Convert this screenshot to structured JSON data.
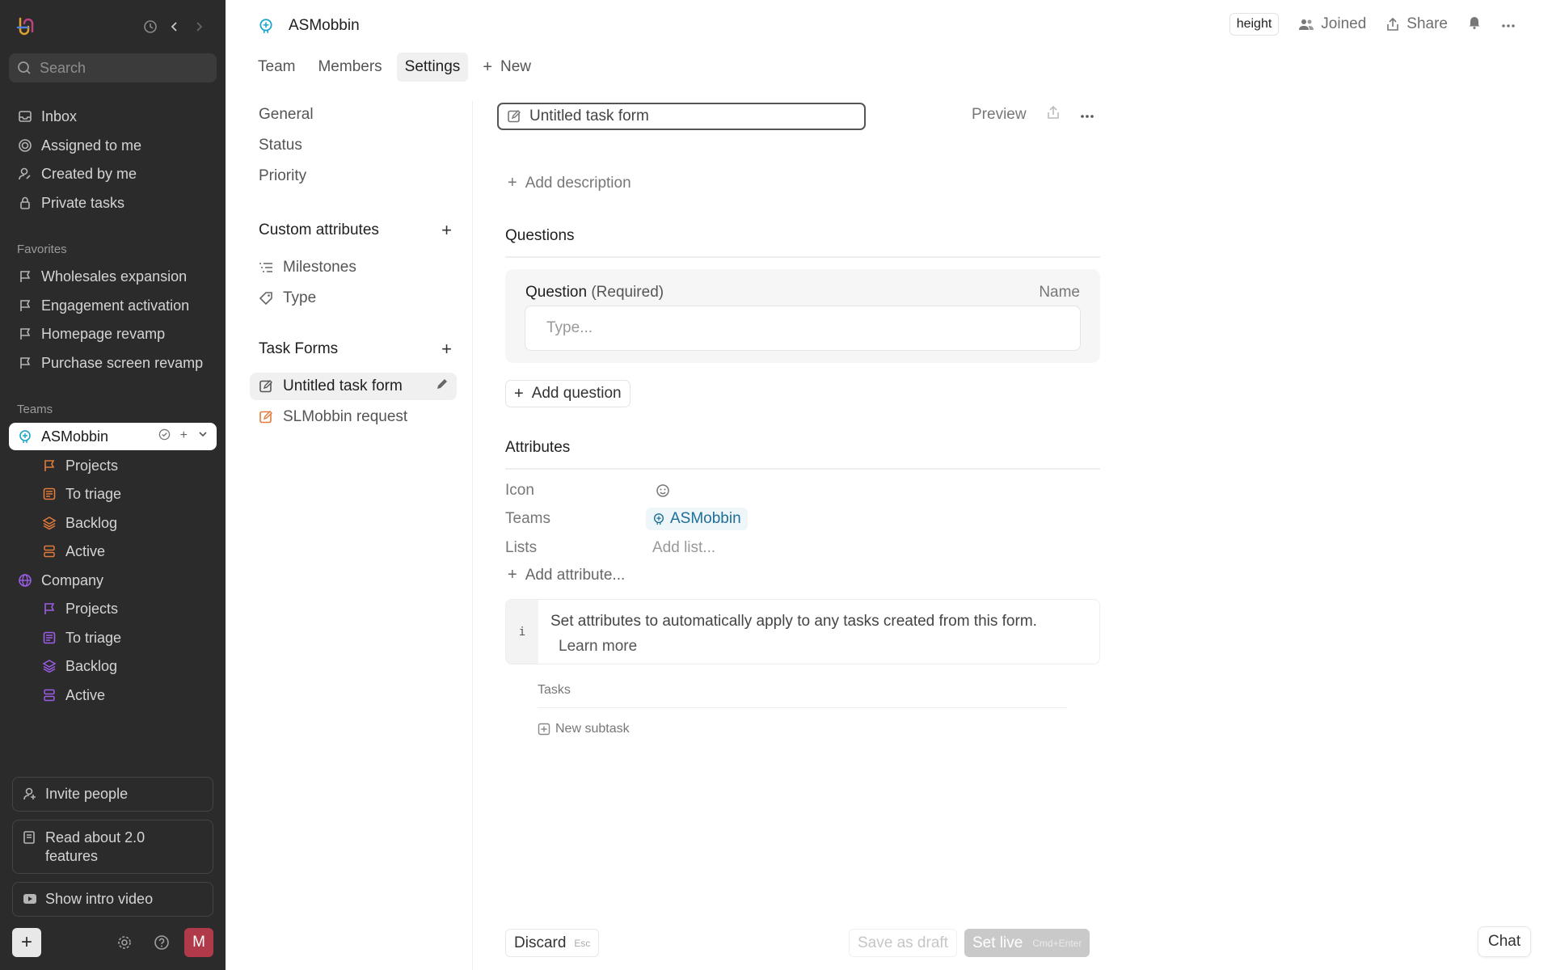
{
  "colors": {
    "sidebar_bg": "#2b2b2b",
    "team_accent": "#1aa3c9",
    "orange": "#e07b3b",
    "purple": "#9b5de5"
  },
  "sidebar": {
    "search_placeholder": "Search",
    "nav": [
      {
        "label": "Inbox",
        "icon": "inbox-icon"
      },
      {
        "label": "Assigned to me",
        "icon": "target-icon"
      },
      {
        "label": "Created by me",
        "icon": "user-edit-icon"
      },
      {
        "label": "Private tasks",
        "icon": "lock-icon"
      }
    ],
    "favorites_label": "Favorites",
    "favorites": [
      {
        "label": "Wholesales expansion",
        "icon": "flag-icon"
      },
      {
        "label": "Engagement activation",
        "icon": "flag-icon"
      },
      {
        "label": "Homepage revamp",
        "icon": "flag-icon"
      },
      {
        "label": "Purchase screen revamp",
        "icon": "flag-icon"
      }
    ],
    "teams_label": "Teams",
    "teams": [
      {
        "label": "ASMobbin",
        "children": [
          {
            "label": "Projects",
            "icon": "flag-icon"
          },
          {
            "label": "To triage",
            "icon": "triage-icon"
          },
          {
            "label": "Backlog",
            "icon": "layers-icon"
          },
          {
            "label": "Active",
            "icon": "stack-icon"
          }
        ]
      },
      {
        "label": "Company",
        "children": [
          {
            "label": "Projects",
            "icon": "flag-icon"
          },
          {
            "label": "To triage",
            "icon": "triage-icon"
          },
          {
            "label": "Backlog",
            "icon": "layers-icon"
          },
          {
            "label": "Active",
            "icon": "stack-icon"
          }
        ]
      }
    ],
    "invite": "Invite people",
    "read_about": "Read about 2.0 features",
    "intro_video": "Show intro video",
    "avatar_initial": "M"
  },
  "header": {
    "title": "ASMobbin",
    "height_badge": "height",
    "joined": "Joined",
    "share": "Share"
  },
  "tabs": [
    {
      "label": "Team"
    },
    {
      "label": "Members"
    },
    {
      "label": "Settings"
    },
    {
      "label": "New"
    }
  ],
  "settings_nav": {
    "general": "General",
    "status": "Status",
    "priority": "Priority",
    "custom_attributes": "Custom attributes",
    "milestones": "Milestones",
    "type": "Type",
    "task_forms": "Task Forms",
    "forms": [
      "Untitled task form",
      "SLMobbin request"
    ]
  },
  "form": {
    "title": "Untitled task form",
    "preview": "Preview",
    "add_description": "Add description",
    "questions_title": "Questions",
    "question_label": "Question",
    "question_required": "(Required)",
    "question_name": "Name",
    "question_placeholder": "Type...",
    "add_question": "Add question",
    "attributes_title": "Attributes",
    "attr_icon": "Icon",
    "attr_teams": "Teams",
    "attr_teams_value": "ASMobbin",
    "attr_lists": "Lists",
    "attr_lists_value": "Add list...",
    "add_attribute": "Add attribute...",
    "info_glyph": "i",
    "info_text": "Set attributes to automatically apply to any tasks created from this form.",
    "learn_more": "Learn more",
    "tasks_label": "Tasks",
    "new_subtask": "New subtask"
  },
  "footer": {
    "discard": "Discard",
    "discard_kbd": "Esc",
    "save_draft": "Save as draft",
    "set_live": "Set live",
    "set_live_kbd": "Cmd+Enter",
    "chat": "Chat"
  }
}
